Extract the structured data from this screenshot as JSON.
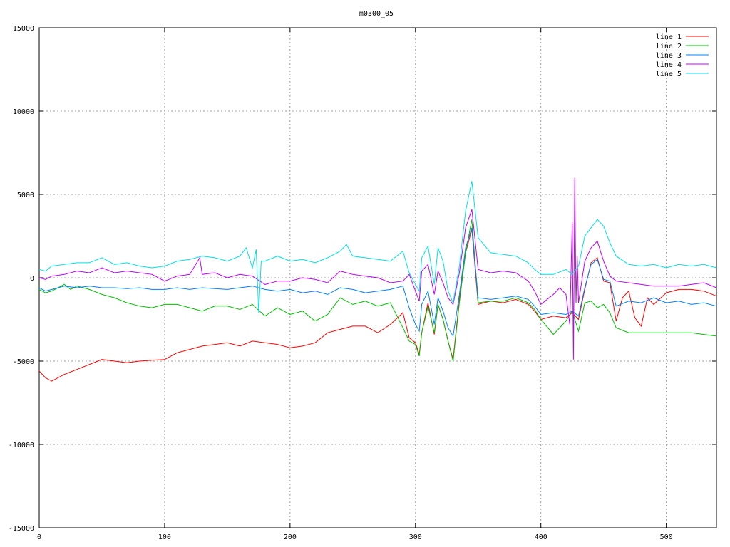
{
  "chart_data": {
    "type": "line",
    "title": "m0300_05",
    "xlabel": "",
    "ylabel": "",
    "xlim": [
      0,
      540
    ],
    "ylim": [
      -15000,
      15000
    ],
    "x_ticks": [
      0,
      100,
      200,
      300,
      400,
      500
    ],
    "y_ticks": [
      -15000,
      -10000,
      -5000,
      0,
      5000,
      10000,
      15000
    ],
    "grid": true,
    "legend_position": "top-right",
    "series": [
      {
        "name": "line 1",
        "color": "#ff0000",
        "x": [
          0,
          5,
          10,
          20,
          30,
          40,
          50,
          60,
          70,
          80,
          90,
          100,
          110,
          120,
          130,
          140,
          150,
          160,
          170,
          180,
          190,
          200,
          210,
          220,
          230,
          240,
          250,
          260,
          270,
          280,
          290,
          295,
          300,
          303,
          305,
          310,
          315,
          318,
          322,
          326,
          330,
          335,
          340,
          345,
          350,
          360,
          370,
          380,
          390,
          395,
          400,
          410,
          420,
          425,
          430,
          435,
          440,
          445,
          450,
          455,
          460,
          465,
          470,
          475,
          480,
          485,
          490,
          500,
          510,
          520,
          530,
          540
        ],
        "y": [
          -5600,
          -6000,
          -6200,
          -5800,
          -5500,
          -5200,
          -4900,
          -5000,
          -5100,
          -5000,
          -4950,
          -4900,
          -4500,
          -4300,
          -4100,
          -4000,
          -3900,
          -4100,
          -3800,
          -3900,
          -4000,
          -4200,
          -4100,
          -3900,
          -3300,
          -3100,
          -2900,
          -2900,
          -3300,
          -2800,
          -2100,
          -3600,
          -3900,
          -4600,
          -3300,
          -1500,
          -3400,
          -1600,
          -2500,
          -3800,
          -4900,
          -1300,
          1500,
          2900,
          -1600,
          -1400,
          -1500,
          -1300,
          -1600,
          -2000,
          -2500,
          -2300,
          -2400,
          -2100,
          -2500,
          -700,
          900,
          1200,
          -200,
          -300,
          -2600,
          -1200,
          -800,
          -2400,
          -2900,
          -1200,
          -1600,
          -900,
          -700,
          -700,
          -800,
          -1100
        ]
      },
      {
        "name": "line 2",
        "color": "#00c000",
        "x": [
          0,
          5,
          10,
          15,
          20,
          25,
          30,
          40,
          50,
          60,
          70,
          80,
          90,
          100,
          110,
          120,
          130,
          140,
          150,
          160,
          170,
          180,
          190,
          200,
          210,
          220,
          230,
          240,
          250,
          260,
          270,
          280,
          290,
          295,
          300,
          303,
          305,
          310,
          315,
          318,
          322,
          326,
          330,
          335,
          340,
          345,
          350,
          360,
          370,
          380,
          390,
          395,
          400,
          410,
          420,
          425,
          430,
          435,
          440,
          445,
          450,
          455,
          460,
          470,
          480,
          490,
          500,
          510,
          520,
          530,
          540
        ],
        "y": [
          -700,
          -900,
          -800,
          -600,
          -400,
          -700,
          -500,
          -700,
          -1000,
          -1200,
          -1500,
          -1700,
          -1800,
          -1600,
          -1600,
          -1800,
          -2000,
          -1700,
          -1700,
          -1900,
          -1600,
          -2300,
          -1800,
          -2200,
          -2000,
          -2600,
          -2200,
          -1200,
          -1600,
          -1400,
          -1700,
          -1500,
          -3000,
          -3800,
          -4000,
          -4700,
          -3300,
          -1700,
          -3300,
          -1600,
          -2500,
          -3800,
          -5000,
          -1500,
          1500,
          3500,
          -1500,
          -1400,
          -1400,
          -1200,
          -1500,
          -1900,
          -2500,
          -3400,
          -2600,
          -2000,
          -3200,
          -1500,
          -1400,
          -1800,
          -1600,
          -2100,
          -3000,
          -3300,
          -3300,
          -3300,
          -3300,
          -3300,
          -3300,
          -3400,
          -3500
        ]
      },
      {
        "name": "line 3",
        "color": "#0080ff",
        "x": [
          0,
          5,
          10,
          20,
          30,
          40,
          50,
          60,
          70,
          80,
          90,
          100,
          110,
          120,
          130,
          140,
          150,
          160,
          170,
          180,
          190,
          200,
          210,
          220,
          230,
          240,
          250,
          260,
          270,
          280,
          290,
          295,
          300,
          303,
          305,
          310,
          315,
          318,
          322,
          326,
          330,
          335,
          340,
          345,
          350,
          360,
          370,
          380,
          390,
          395,
          400,
          410,
          420,
          425,
          430,
          435,
          440,
          445,
          450,
          455,
          460,
          470,
          480,
          490,
          500,
          510,
          520,
          530,
          540
        ],
        "y": [
          -600,
          -800,
          -700,
          -500,
          -600,
          -500,
          -600,
          -600,
          -650,
          -600,
          -700,
          -700,
          -600,
          -700,
          -600,
          -650,
          -700,
          -600,
          -500,
          -700,
          -800,
          -700,
          -900,
          -800,
          -1000,
          -600,
          -700,
          -900,
          -800,
          -700,
          -500,
          -1800,
          -2800,
          -3200,
          -1600,
          -800,
          -2800,
          -1200,
          -2000,
          -3000,
          -3500,
          -1000,
          1800,
          3000,
          -1200,
          -1300,
          -1200,
          -1100,
          -1300,
          -1700,
          -2200,
          -2100,
          -2200,
          -2000,
          -2300,
          -600,
          800,
          1100,
          -100,
          -200,
          -1700,
          -1400,
          -1500,
          -1200,
          -1500,
          -1400,
          -1600,
          -1500,
          -1700
        ]
      },
      {
        "name": "line 4",
        "color": "#c000ff",
        "x": [
          0,
          5,
          10,
          20,
          30,
          40,
          50,
          60,
          70,
          80,
          90,
          100,
          110,
          120,
          128,
          130,
          140,
          150,
          160,
          170,
          180,
          190,
          200,
          210,
          220,
          230,
          240,
          250,
          260,
          270,
          280,
          290,
          295,
          300,
          303,
          305,
          310,
          315,
          318,
          322,
          326,
          330,
          335,
          340,
          345,
          350,
          360,
          370,
          380,
          390,
          395,
          400,
          410,
          415,
          420,
          423,
          425,
          426,
          427,
          428,
          429,
          430,
          435,
          440,
          445,
          450,
          455,
          460,
          470,
          480,
          490,
          500,
          510,
          520,
          530,
          540
        ],
        "y": [
          0,
          -100,
          100,
          200,
          400,
          300,
          600,
          300,
          400,
          300,
          200,
          -200,
          100,
          200,
          1200,
          200,
          300,
          0,
          200,
          100,
          -400,
          -200,
          -200,
          0,
          -100,
          -300,
          400,
          200,
          100,
          0,
          -300,
          -200,
          200,
          -800,
          -1400,
          400,
          800,
          -1000,
          400,
          -300,
          -1200,
          -1600,
          300,
          3000,
          4100,
          500,
          300,
          400,
          300,
          -200,
          -800,
          -1600,
          -1000,
          -600,
          -1000,
          -2800,
          3300,
          -4900,
          6000,
          -1500,
          1300,
          -1500,
          1000,
          1800,
          2200,
          1000,
          100,
          -200,
          -300,
          -400,
          -500,
          -500,
          -500,
          -400,
          -300,
          -600
        ]
      },
      {
        "name": "line 5",
        "color": "#00e0e0",
        "x": [
          0,
          5,
          10,
          20,
          30,
          40,
          50,
          60,
          70,
          80,
          90,
          100,
          110,
          120,
          130,
          140,
          150,
          160,
          165,
          170,
          173,
          175,
          177,
          180,
          190,
          200,
          210,
          220,
          230,
          240,
          245,
          250,
          260,
          270,
          280,
          290,
          295,
          300,
          303,
          305,
          310,
          315,
          318,
          322,
          326,
          330,
          335,
          340,
          345,
          350,
          360,
          370,
          380,
          390,
          395,
          400,
          410,
          420,
          425,
          430,
          435,
          440,
          445,
          450,
          455,
          460,
          470,
          480,
          490,
          500,
          510,
          520,
          530,
          540
        ],
        "y": [
          500,
          400,
          700,
          800,
          900,
          900,
          1200,
          800,
          900,
          700,
          600,
          700,
          1000,
          1100,
          1300,
          1200,
          1000,
          1300,
          1800,
          600,
          1700,
          -2100,
          1000,
          1000,
          1300,
          1000,
          1100,
          900,
          1200,
          1600,
          2000,
          1300,
          1200,
          1100,
          1000,
          1600,
          300,
          -400,
          -800,
          1200,
          1900,
          -400,
          1800,
          1000,
          -800,
          -1500,
          700,
          4000,
          5800,
          2400,
          1500,
          1400,
          1300,
          900,
          500,
          200,
          200,
          500,
          200,
          700,
          2500,
          3000,
          3500,
          3100,
          2100,
          1300,
          800,
          700,
          800,
          600,
          800,
          700,
          800,
          600
        ]
      }
    ]
  }
}
